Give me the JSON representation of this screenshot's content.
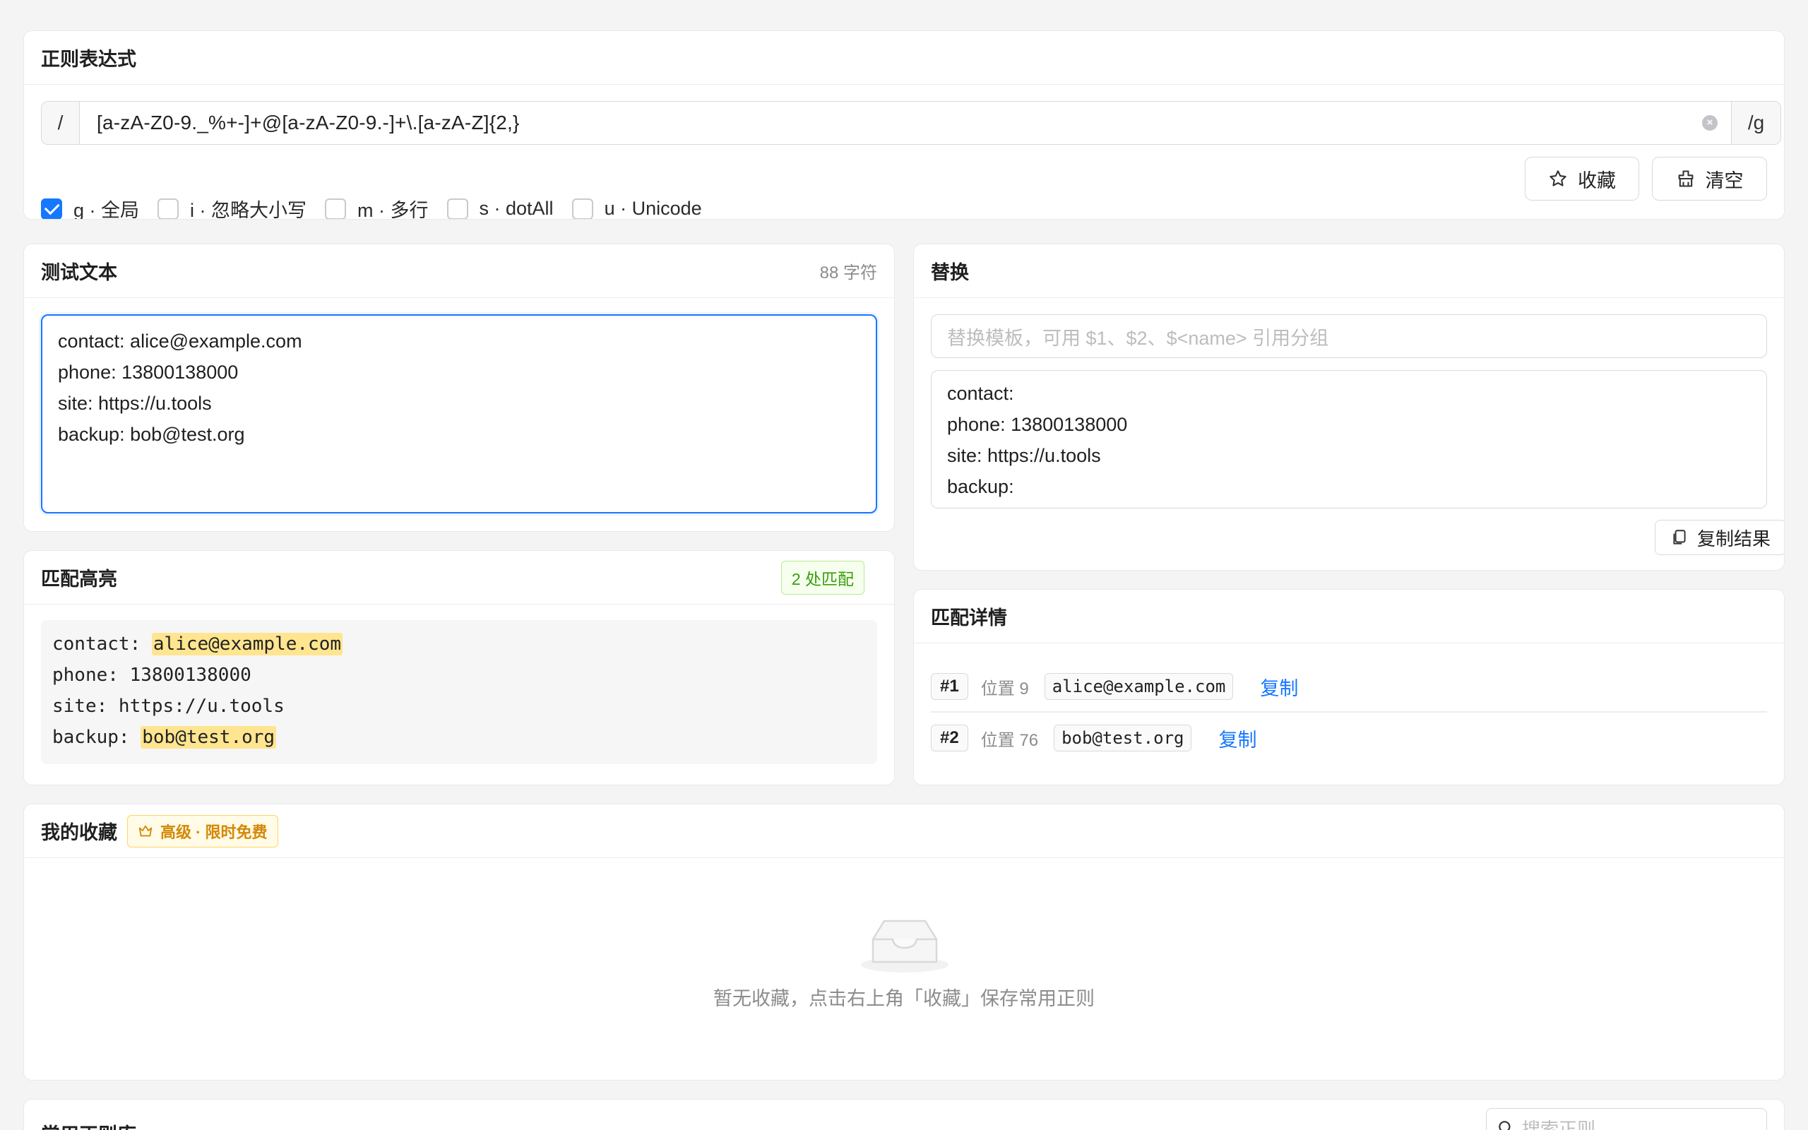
{
  "regex": {
    "title": "正则表达式",
    "open_slash": "/",
    "pattern": "[a-zA-Z0-9._%+-]+@[a-zA-Z0-9.-]+\\.[a-zA-Z]{2,}",
    "close_flags": "/g",
    "flags": [
      {
        "label": "g · 全局",
        "checked": true
      },
      {
        "label": "i · 忽略大小写",
        "checked": false
      },
      {
        "label": "m · 多行",
        "checked": false
      },
      {
        "label": "s · dotAll",
        "checked": false
      },
      {
        "label": "u · Unicode",
        "checked": false
      }
    ],
    "favorite_label": "收藏",
    "clear_label": "清空"
  },
  "test": {
    "title": "测试文本",
    "char_count": "88 字符",
    "lines": [
      "contact: alice@example.com",
      "phone: 13800138000",
      "site: https://u.tools",
      "backup: bob@test.org"
    ]
  },
  "replace": {
    "title": "替换",
    "placeholder": "替换模板，可用 $1、$2、$<name> 引用分组",
    "result_lines": [
      "contact:",
      "phone: 13800138000",
      "site: https://u.tools",
      "backup:"
    ],
    "copy_label": "复制结果"
  },
  "highlight": {
    "title": "匹配高亮",
    "badge": "2 处匹配",
    "lines": [
      {
        "pre": "contact: ",
        "match": "alice@example.com"
      },
      {
        "pre": "phone: 13800138000",
        "match": ""
      },
      {
        "pre": "site: https://u.tools",
        "match": ""
      },
      {
        "pre": "backup: ",
        "match": "bob@test.org"
      }
    ]
  },
  "details": {
    "title": "匹配详情",
    "matches": [
      {
        "index": "#1",
        "position": "位置 9",
        "value": "alice@example.com",
        "copy": "复制"
      },
      {
        "index": "#2",
        "position": "位置 76",
        "value": "bob@test.org",
        "copy": "复制"
      }
    ]
  },
  "favorites": {
    "title": "我的收藏",
    "badge": "高级 · 限时免费",
    "empty": "暂无收藏，点击右上角「收藏」保存常用正则"
  },
  "library": {
    "title": "常用正则库",
    "search_placeholder": "搜索正则"
  },
  "colors": {
    "accent": "#1677ff",
    "highlight": "#ffe58f",
    "success": "#389e0d",
    "gold": "#d48806"
  }
}
